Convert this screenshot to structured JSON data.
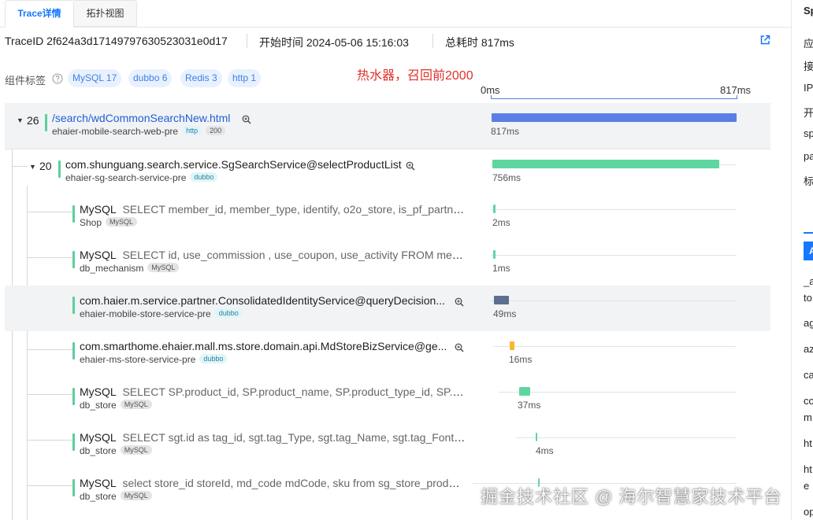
{
  "tabs": {
    "active": "Trace详情",
    "inactive": "拓扑视图"
  },
  "info": {
    "trace_id": "TraceID 2f624a3d17149797630523031e0d17",
    "start_time": "开始时间 2024-05-06 15:16:03",
    "total_time": "总耗时 817ms"
  },
  "tags": {
    "label": "组件标签",
    "chips": [
      "MySQL 17",
      "dubbo 6",
      "Redis 3",
      "http 1"
    ]
  },
  "note": "热水器，召回前2000",
  "scale": {
    "start": "0ms",
    "end": "817ms"
  },
  "spans": [
    {
      "count": "26",
      "kind": "",
      "title": "/search/wdCommonSearchNew.html",
      "service": "ehaier-mobile-search-web-pre",
      "badges": [
        "http",
        "200"
      ],
      "duration": "817ms",
      "bar_color": "#5b7ee5"
    },
    {
      "count": "20",
      "kind": "",
      "title": "com.shunguang.search.service.SgSearchService@selectProductList",
      "service": "ehaier-sg-search-service-pre",
      "badges": [
        "dubbo"
      ],
      "duration": "756ms",
      "bar_color": "#5fd6a0"
    },
    {
      "kind": "MySQL",
      "title": "SELECT member_id, member_type, identify, o2o_store, is_pf_partner F...",
      "service": "Shop",
      "badges": [
        "MySQL"
      ],
      "duration": "2ms",
      "bar_color": "#5fd6a0"
    },
    {
      "kind": "MySQL",
      "title": "SELECT id, use_commission , use_coupon, use_activity FROM membe...",
      "service": "db_mechanism",
      "badges": [
        "MySQL"
      ],
      "duration": "1ms",
      "bar_color": "#5fd6a0"
    },
    {
      "kind": "",
      "title": "com.haier.m.service.partner.ConsolidatedIdentityService@queryDecision...",
      "service": "ehaier-mobile-store-service-pre",
      "badges": [
        "dubbo"
      ],
      "duration": "49ms",
      "bar_color": "#5c6f8f"
    },
    {
      "kind": "",
      "title": "com.smarthome.ehaier.mall.ms.store.domain.api.MdStoreBizService@ge...",
      "service": "ehaier-ms-store-service-pre",
      "badges": [
        "dubbo"
      ],
      "duration": "16ms",
      "bar_color": "#f5b82e"
    },
    {
      "kind": "MySQL",
      "title": "SELECT SP.product_id, SP.product_name, SP.product_type_id, SP.prod...",
      "service": "db_store",
      "badges": [
        "MySQL"
      ],
      "duration": "37ms",
      "bar_color": "#5fd6a0"
    },
    {
      "kind": "MySQL",
      "title": "SELECT sgt.id as tag_id, sgt.tag_Type, sgt.tag_Name, sgt.tag_Font_Co...",
      "service": "db_store",
      "badges": [
        "MySQL"
      ],
      "duration": "4ms",
      "bar_color": "#5fd6a0"
    },
    {
      "kind": "MySQL",
      "title": "select store_id storeId, md_code mdCode, sku from sg_store_product...",
      "service": "db_store",
      "badges": [
        "MySQL"
      ],
      "duration": "",
      "bar_color": "#5fd6a0"
    }
  ],
  "right_panel": {
    "header": "Sp",
    "items": [
      "应",
      "接",
      "IP",
      "开",
      "sp",
      "pa",
      "标"
    ],
    "button": "A",
    "items2": [
      "_a",
      "to",
      "ag",
      "az",
      "ca",
      "co",
      "m",
      "ht",
      "ht",
      "e",
      "op"
    ]
  },
  "watermark": "掘金技术社区 @ 海尔智慧家技术平台"
}
